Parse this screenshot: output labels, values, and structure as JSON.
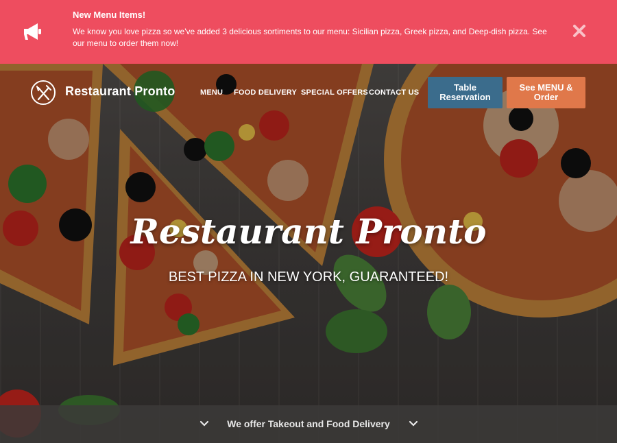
{
  "announcement": {
    "title": "New Menu Items!",
    "text": "We know you love pizza so we've added 3 delicious sortiments to our menu: Sicilian pizza, Greek pizza, and Deep-dish pizza. See our menu to order them now!",
    "icon": "megaphone-icon",
    "close_icon": "close-icon",
    "color": "#ee4d5f"
  },
  "header": {
    "brand": "Restaurant Pronto",
    "logo_icon": "fork-knife-icon",
    "nav": [
      "MENU",
      "FOOD DELIVERY",
      "SPECIAL OFFERS",
      "CONTACT US"
    ],
    "reserve_button": "Table Reservation",
    "menu_button": "See MENU & Order",
    "reserve_color": "#3b6c8c",
    "menu_color": "#e0784a"
  },
  "hero": {
    "title": "Restaurant Pronto",
    "subtitle": "BEST PIZZA IN NEW YORK, GUARANTEED!"
  },
  "bottom_bar": {
    "text": "We offer Takeout and Food Delivery",
    "icon": "chevron-down-icon"
  }
}
